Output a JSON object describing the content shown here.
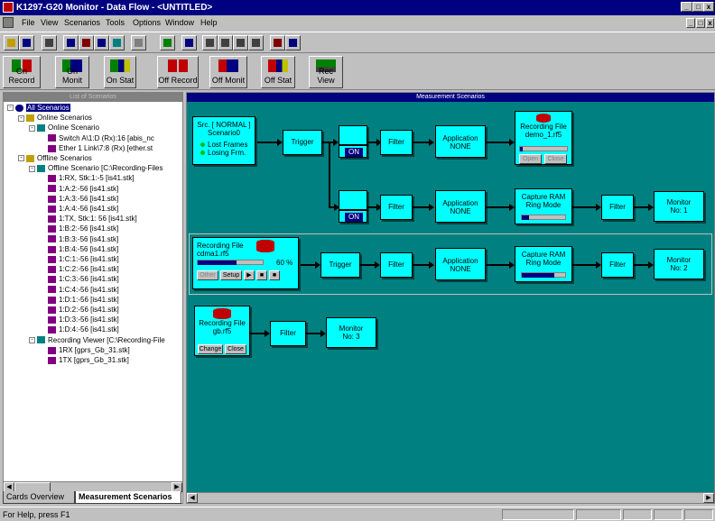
{
  "window": {
    "title": "K1297-G20 Monitor - Data Flow - <UNTITLED>"
  },
  "menu": [
    "File",
    "View",
    "Scenarios",
    "Tools",
    "Options",
    "Window",
    "Help"
  ],
  "toolbar2": [
    {
      "label": "On Record",
      "icon": "on-record-icon"
    },
    {
      "label": "On Monit",
      "icon": "on-monit-icon"
    },
    {
      "label": "On Stat",
      "icon": "on-stat-icon"
    },
    {
      "label": "Off Record",
      "icon": "off-record-icon"
    },
    {
      "label": "Off Monit",
      "icon": "off-monit-icon"
    },
    {
      "label": "Off Stat",
      "icon": "off-stat-icon"
    },
    {
      "label": "Rec View",
      "icon": "rec-view-icon"
    }
  ],
  "left": {
    "header": "List of Scenarios",
    "tree": [
      {
        "label": "All Scenarios",
        "level": 0,
        "pm": "-",
        "icon": "globe"
      },
      {
        "label": "Online Scenarios",
        "level": 1,
        "pm": "-",
        "icon": "scen"
      },
      {
        "label": "Online Scenario",
        "level": 2,
        "pm": "-",
        "icon": "folder"
      },
      {
        "label": "Switch A\\1:D (Rx):16   [abis_nc",
        "level": 3,
        "pm": "",
        "icon": "probe"
      },
      {
        "label": "Ether 1 Link\\7:8 (Rx)   [ether.st",
        "level": 3,
        "pm": "",
        "icon": "probe"
      },
      {
        "label": "Offline Scenarios",
        "level": 1,
        "pm": "-",
        "icon": "scen"
      },
      {
        "label": "Offline Scenario [C:\\Recording-Files",
        "level": 2,
        "pm": "-",
        "icon": "folder"
      },
      {
        "label": "1:RX, Stk:1:-5   [is41.stk]",
        "level": 3,
        "pm": "",
        "icon": "probe"
      },
      {
        "label": "1:A:2:-56   [is41.stk]",
        "level": 3,
        "pm": "",
        "icon": "probe"
      },
      {
        "label": "1:A:3:-56   [is41.stk]",
        "level": 3,
        "pm": "",
        "icon": "probe"
      },
      {
        "label": "1:A:4:-56   [is41.stk]",
        "level": 3,
        "pm": "",
        "icon": "probe"
      },
      {
        "label": "1:TX, Stk:1: 56   [is41.stk]",
        "level": 3,
        "pm": "",
        "icon": "probe"
      },
      {
        "label": "1:B:2:-56   [is41.stk]",
        "level": 3,
        "pm": "",
        "icon": "probe"
      },
      {
        "label": "1:B:3:-56   [is41.stk]",
        "level": 3,
        "pm": "",
        "icon": "probe"
      },
      {
        "label": "1:B:4:-56   [is41.stk]",
        "level": 3,
        "pm": "",
        "icon": "probe"
      },
      {
        "label": "1:C:1:-56   [is41.stk]",
        "level": 3,
        "pm": "",
        "icon": "probe"
      },
      {
        "label": "1:C:2:-56   [is41.stk]",
        "level": 3,
        "pm": "",
        "icon": "probe"
      },
      {
        "label": "1:C:3:-56   [is41.stk]",
        "level": 3,
        "pm": "",
        "icon": "probe"
      },
      {
        "label": "1:C:4:-56   [is41.stk]",
        "level": 3,
        "pm": "",
        "icon": "probe"
      },
      {
        "label": "1:D:1:-56   [is41.stk]",
        "level": 3,
        "pm": "",
        "icon": "probe"
      },
      {
        "label": "1:D:2:-56   [is41.stk]",
        "level": 3,
        "pm": "",
        "icon": "probe"
      },
      {
        "label": "1:D:3:-56   [is41.stk]",
        "level": 3,
        "pm": "",
        "icon": "probe"
      },
      {
        "label": "1:D:4:-56   [is41.stk]",
        "level": 3,
        "pm": "",
        "icon": "probe"
      },
      {
        "label": "Recording Viewer [C:\\Recording-File",
        "level": 2,
        "pm": "-",
        "icon": "folder"
      },
      {
        "label": "1RX   [gprs_Gb_31.stk]",
        "level": 3,
        "pm": "",
        "icon": "probe"
      },
      {
        "label": "1TX   [gprs_Gb_31.stk]",
        "level": 3,
        "pm": "",
        "icon": "probe"
      }
    ],
    "tabs": [
      "Cards Overview",
      "Measurement Scenarios"
    ]
  },
  "right": {
    "header": "Measurement Scenarios",
    "src": {
      "line1": "Src. [ NORMAL ]",
      "line2": "Scenario0",
      "ind1": "Lost Frames",
      "ind2": "Losing Frm."
    },
    "trigger": "Trigger",
    "on": "ON",
    "filter": "Filter",
    "application": "Application",
    "none": "NONE",
    "rec1": {
      "title": "Recording File",
      "file": "demo_1.rf5",
      "open": "Open",
      "close": "Close"
    },
    "capture": {
      "line1": "Capture RAM",
      "line2": "Ring Mode"
    },
    "monitor1": {
      "line1": "Monitor",
      "line2": "No: 1"
    },
    "rec2": {
      "title": "Recording File",
      "file": "cdma1.rf5",
      "pct": "60 %",
      "progress": 0.6,
      "b1": "Other",
      "b2": "Setup"
    },
    "monitor2": {
      "line1": "Monitor",
      "line2": "No: 2"
    },
    "rec3": {
      "title": "Recording File",
      "file": "gb.rf5",
      "b1": "Change",
      "b2": "Close"
    },
    "monitor3": {
      "line1": "Monitor",
      "line2": "No: 3"
    }
  },
  "status": "For Help, press F1"
}
